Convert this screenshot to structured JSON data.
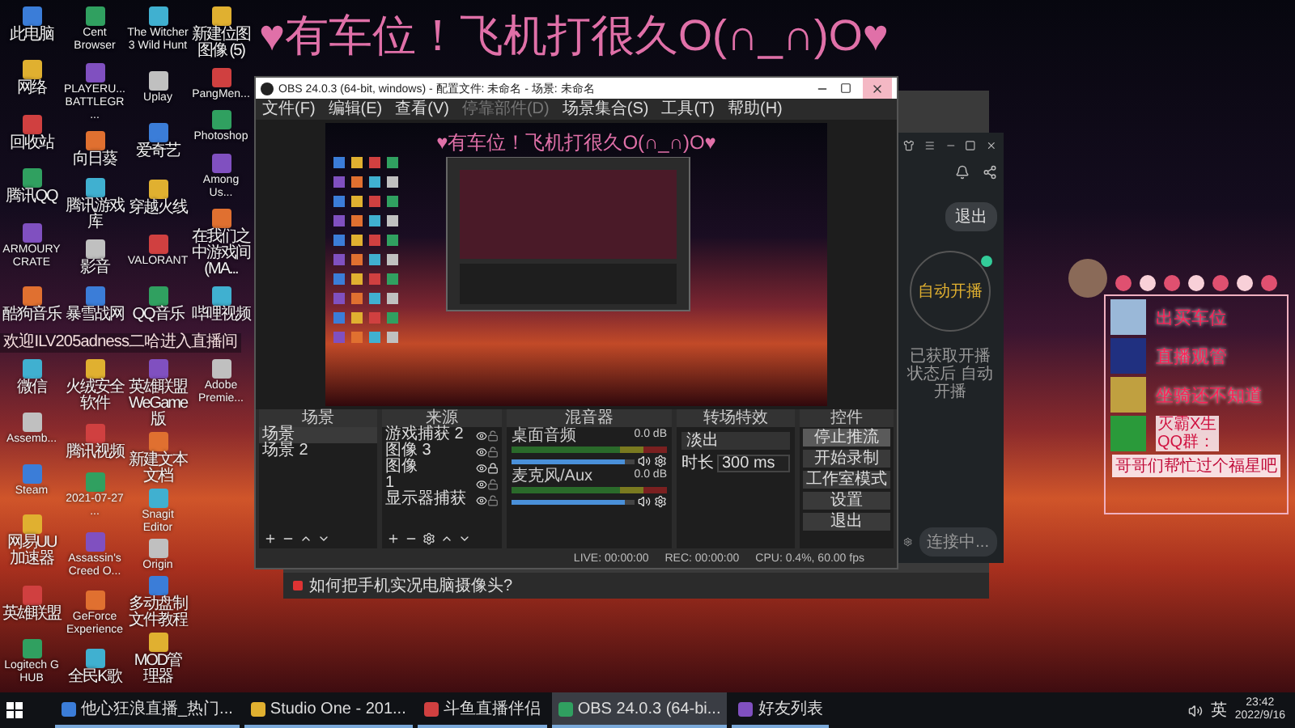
{
  "banner": "♥有车位！飞机打很久O(∩_∩)O♥",
  "desktop_columns": [
    {
      "items": [
        "此电脑",
        "网络",
        "回收站",
        "腾讯QQ",
        "ARMOURY CRATE",
        "酷狗音乐",
        "微信",
        "Assemb...",
        "Steam",
        "网易UU加速器",
        "英雄联盟",
        "Logitech G HUB"
      ]
    },
    {
      "items": [
        "Cent Browser",
        "PLAYERU... BATTLEGR...",
        "向日葵",
        "腾讯游戏库",
        "影音",
        "暴雪战网",
        "火绒安全软件",
        "腾讯视频",
        "2021-07-27 ...",
        "Assassin's Creed O...",
        "GeForce Experience",
        "全民K歌"
      ]
    },
    {
      "items": [
        "The Witcher 3 Wild Hunt",
        "Uplay",
        "爱奇艺",
        "穿越火线",
        "VALORANT",
        "QQ音乐",
        "英雄联盟 WeGame版",
        "新建文本文档",
        "Snagit Editor",
        "Origin",
        "多动盘制文件教程",
        "MOD管理器"
      ]
    },
    {
      "items": [
        "新建位图图像 (5)",
        "PangMen...",
        "Photoshop",
        "Among Us...",
        "在我们之中游戏间(MA...",
        "哔哩视频",
        "Adobe Premie..."
      ]
    }
  ],
  "welcome_message": "欢迎ILV205adness二哈进入直播间",
  "preview": {
    "banner": "♥有车位！飞机打很久O(∩_∩)O♥"
  },
  "back_window": {
    "question": "如何把手机实况电脑摄像头?"
  },
  "side_app": {
    "exit_button": "退出",
    "auto_start": "自动开播",
    "auto_start_note": "已获取开播状态后 自动开播",
    "connect_button": "连接中..."
  },
  "obs": {
    "title": "OBS 24.0.3 (64-bit, windows) - 配置文件: 未命名 - 场景: 未命名",
    "menu": [
      {
        "label": "文件(F)",
        "disabled": false
      },
      {
        "label": "编辑(E)",
        "disabled": false
      },
      {
        "label": "查看(V)",
        "disabled": false
      },
      {
        "label": "停靠部件(D)",
        "disabled": true
      },
      {
        "label": "场景集合(S)",
        "disabled": false
      },
      {
        "label": "工具(T)",
        "disabled": false
      },
      {
        "label": "帮助(H)",
        "disabled": false
      }
    ],
    "docks": {
      "scenes": "场景",
      "sources": "来源",
      "mixer": "混音器",
      "transitions": "转场特效",
      "controls": "控件"
    },
    "scenes": [
      {
        "label": "场景",
        "selected": true
      },
      {
        "label": "场景 2",
        "selected": false
      }
    ],
    "sources": [
      {
        "label": "游戏捕获 2",
        "locked": false
      },
      {
        "label": "图像 3",
        "locked": false
      },
      {
        "label": "图像",
        "locked": true
      },
      {
        "label": "1",
        "locked": false
      },
      {
        "label": "显示器捕获",
        "locked": false
      }
    ],
    "mixer": [
      {
        "name": "桌面音频",
        "reading": "0.0 dB",
        "level": 0.92
      },
      {
        "name": "麦克风/Aux",
        "reading": "0.0 dB",
        "level": 0.92
      }
    ],
    "transition": {
      "type": "淡出",
      "duration_label": "时长",
      "duration": "300 ms"
    },
    "controls": [
      {
        "label": "停止推流",
        "active": true
      },
      {
        "label": "开始录制",
        "active": false
      },
      {
        "label": "工作室模式",
        "active": false
      },
      {
        "label": "设置",
        "active": false
      },
      {
        "label": "退出",
        "active": false
      }
    ],
    "status": {
      "live": "LIVE: 00:00:00",
      "rec": "REC: 00:00:00",
      "cpu": "CPU: 0.4%, 60.00 fps"
    }
  },
  "overlay": {
    "rows": [
      "出买车位",
      "直播观管",
      "坐骑还不知道"
    ],
    "contact": [
      "灭霸X生",
      "QQ群："
    ],
    "footer": "哥哥们帮忙过个福星吧"
  },
  "taskbar": {
    "items": [
      {
        "label": "他心狂浪直播_热门...",
        "selected": false
      },
      {
        "label": "Studio One - 201...",
        "selected": false
      },
      {
        "label": "斗鱼直播伴侣",
        "selected": false
      },
      {
        "label": "OBS 24.0.3 (64-bi...",
        "selected": true
      },
      {
        "label": "好友列表",
        "selected": false
      }
    ],
    "input_language": "英",
    "time": "23:42",
    "date": "2022/9/16"
  }
}
